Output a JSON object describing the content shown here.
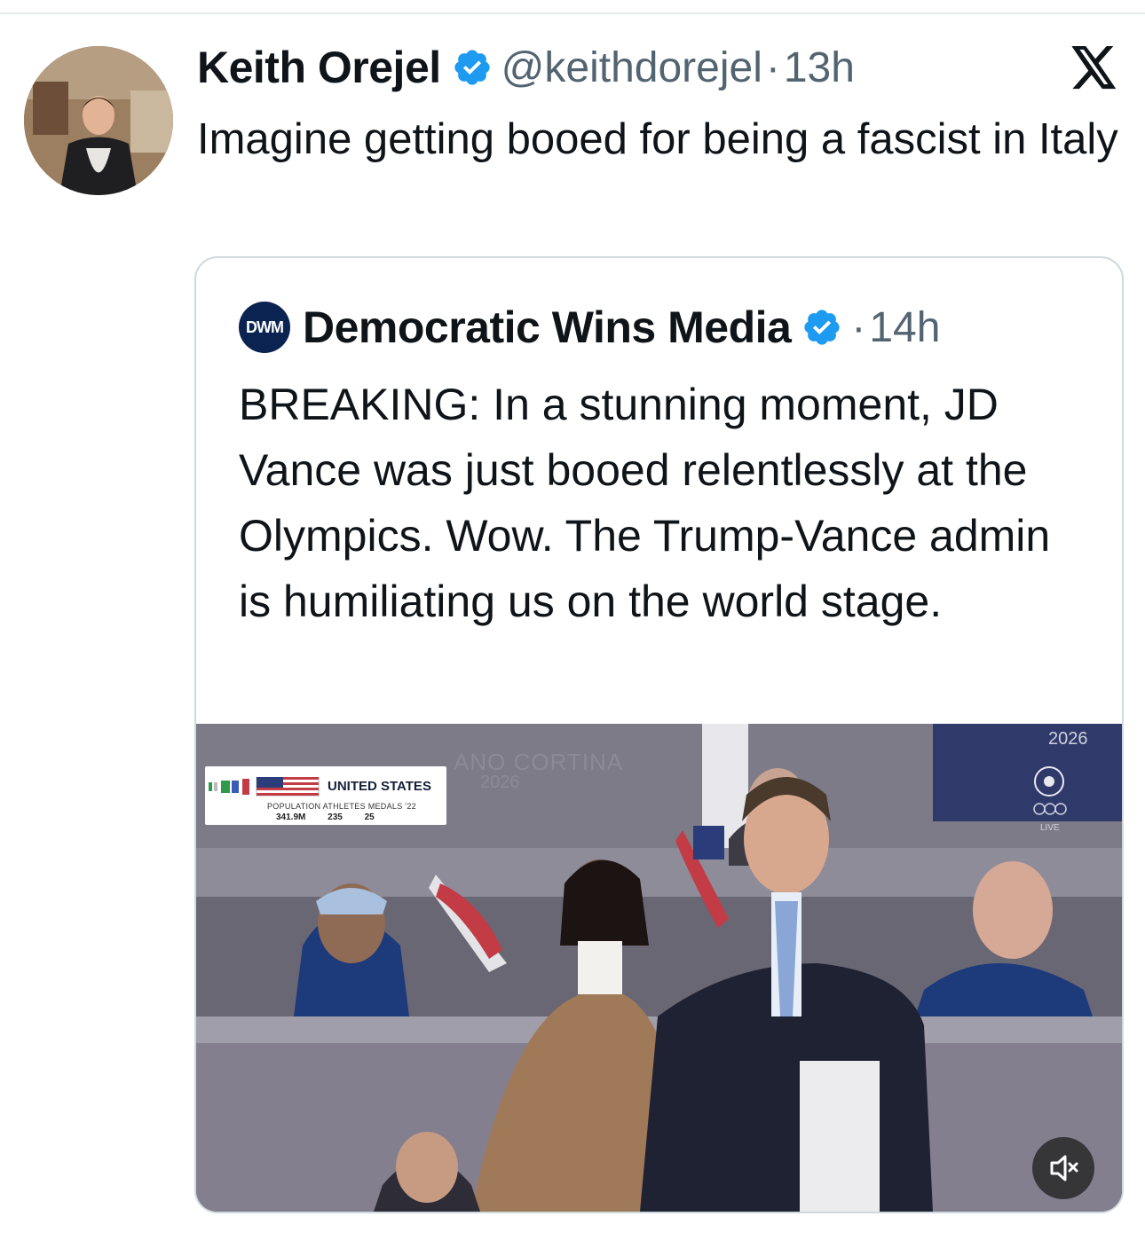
{
  "tweet": {
    "author_name": "Keith Orejel",
    "handle": "@keithdorejel",
    "separator": "·",
    "time": "13h",
    "text": "Imagine getting booed for being a fascist in Italy"
  },
  "quoted_tweet": {
    "logo_text": "DWM",
    "author_name": "Democratic Wins Media",
    "separator": "·",
    "time": "14h",
    "text": "BREAKING: In a stunning moment, JD Vance was just booed relentlessly at the Olympics. Wow. The Trump-Vance admin is humiliating us on the world stage."
  },
  "video": {
    "scorebox_country": "UNITED STATES",
    "scorebox_labels": "POPULATION  ATHLETES  MEDALS '22",
    "scorebox_values": "341.9M 235 25",
    "watermark_line1": "ANO CORTINA",
    "watermark_line2": "2026",
    "corner_year": "2026",
    "live_label": "LIVE"
  },
  "icons": {
    "verified": "verified-badge-icon",
    "platform": "x-logo-icon",
    "mute": "mute-icon"
  },
  "colors": {
    "verified": "#1d9bf0",
    "text": "#0f1419",
    "secondary": "#536471",
    "border": "#cfd9de"
  }
}
